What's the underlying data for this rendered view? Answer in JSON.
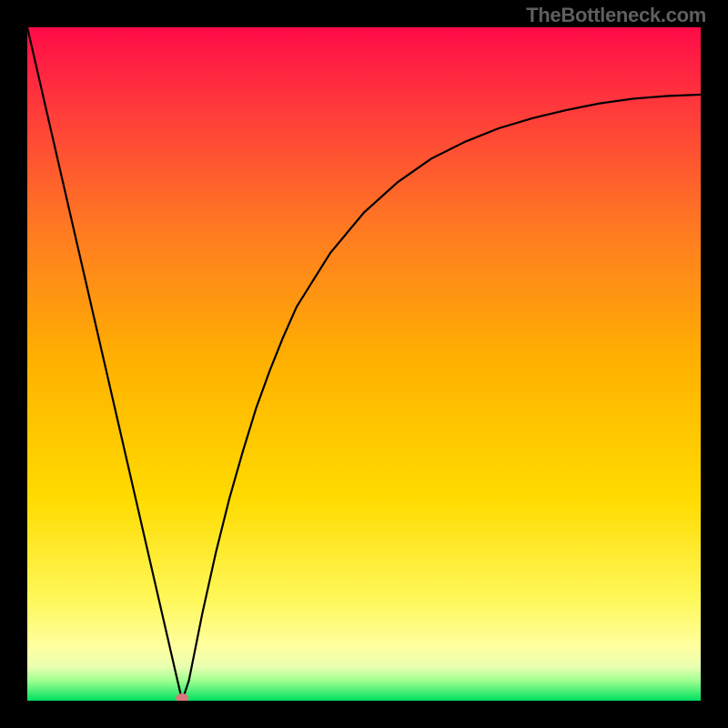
{
  "attribution": "TheBottleneck.com",
  "chart_data": {
    "type": "line",
    "title": "",
    "xlabel": "",
    "ylabel": "",
    "xlim": [
      0,
      100
    ],
    "ylim": [
      0,
      100
    ],
    "x": [
      0,
      2,
      4,
      6,
      8,
      10,
      12,
      14,
      16,
      18,
      20,
      22,
      23,
      24,
      26,
      28,
      30,
      32,
      34,
      36,
      38,
      40,
      45,
      50,
      55,
      60,
      65,
      70,
      75,
      80,
      85,
      90,
      95,
      100
    ],
    "y": [
      100,
      91.3,
      82.6,
      73.9,
      65.2,
      56.5,
      47.8,
      39.1,
      30.4,
      21.7,
      13.0,
      4.3,
      0.0,
      3.0,
      13.0,
      22.0,
      30.0,
      37.0,
      43.5,
      49.0,
      54.0,
      58.5,
      66.5,
      72.5,
      77.0,
      80.5,
      83.0,
      85.0,
      86.5,
      87.7,
      88.7,
      89.4,
      89.8,
      90.0
    ],
    "minimum_marker": {
      "x": 23,
      "y": 0
    },
    "background": {
      "type": "gradient",
      "top_color": "#ff0a47",
      "mid_color": "#ffb200",
      "near_bottom_color": "#ffff66",
      "bottom_color": "#00e060"
    }
  }
}
